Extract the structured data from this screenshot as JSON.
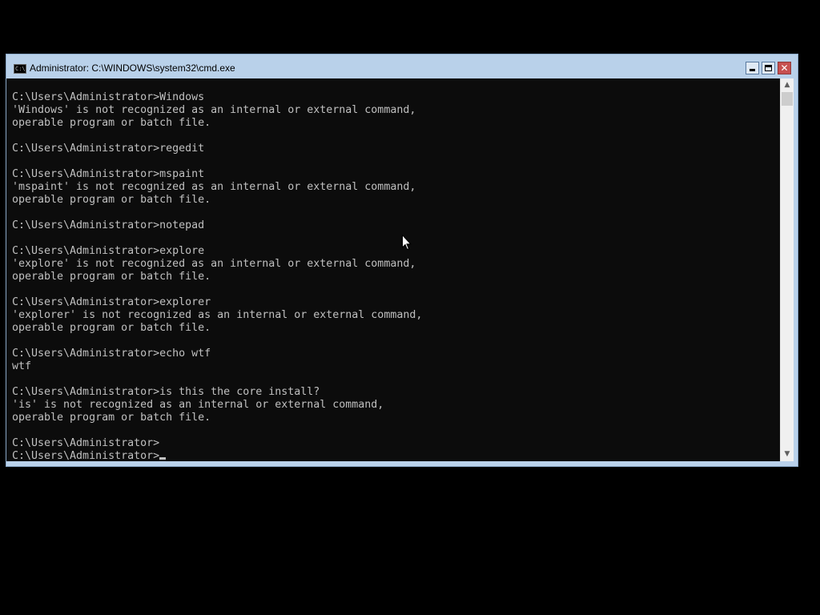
{
  "window": {
    "title": "Administrator: C:\\WINDOWS\\system32\\cmd.exe",
    "icon": "cmd-icon",
    "icon_text": "C:\\",
    "controls": {
      "minimize_icon": "minimize-icon",
      "maximize_icon": "maximize-icon",
      "close_icon": "close-icon",
      "close_glyph": "✕"
    }
  },
  "console": {
    "text_color": "#c0c0c0",
    "background": "#0c0c0c",
    "lines": [
      "C:\\Users\\Administrator>Windows",
      "'Windows' is not recognized as an internal or external command,",
      "operable program or batch file.",
      "",
      "C:\\Users\\Administrator>regedit",
      "",
      "C:\\Users\\Administrator>mspaint",
      "'mspaint' is not recognized as an internal or external command,",
      "operable program or batch file.",
      "",
      "C:\\Users\\Administrator>notepad",
      "",
      "C:\\Users\\Administrator>explore",
      "'explore' is not recognized as an internal or external command,",
      "operable program or batch file.",
      "",
      "C:\\Users\\Administrator>explorer",
      "'explorer' is not recognized as an internal or external command,",
      "operable program or batch file.",
      "",
      "C:\\Users\\Administrator>echo wtf",
      "wtf",
      "",
      "C:\\Users\\Administrator>is this the core install?",
      "'is' is not recognized as an internal or external command,",
      "operable program or batch file.",
      "",
      "C:\\Users\\Administrator>",
      "C:\\Users\\Administrator>"
    ]
  },
  "scrollbar": {
    "up_glyph": "▲",
    "down_glyph": "▼"
  }
}
